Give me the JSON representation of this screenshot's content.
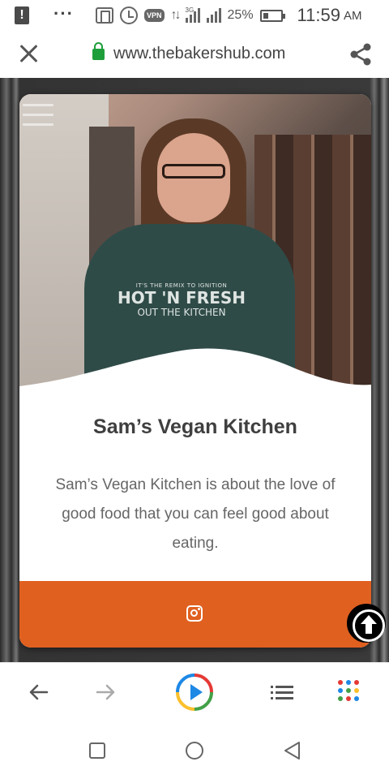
{
  "status_bar": {
    "alert_glyph": "!",
    "overflow_glyph": "···",
    "vpn_label": "VPN",
    "network_label": "3G",
    "battery": "25%",
    "time": "11:59",
    "ampm": "AM"
  },
  "browser": {
    "url": "www.thebakershub.com",
    "close_icon": "close-icon",
    "share_icon": "share-icon"
  },
  "hero": {
    "shirt_line1": "IT'S THE REMIX TO IGNITION",
    "shirt_line2": "HOT 'N FRESH",
    "shirt_line3": "OUT THE KITCHEN"
  },
  "card": {
    "title": "Sam’s Vegan Kitchen",
    "description": "Sam’s Vegan Kitchen is about the love of good food that you can feel good about eating.",
    "footer_icon": "instagram-icon"
  },
  "colors": {
    "accent": "#E06020",
    "lock_green": "#1E9E3A",
    "title_text": "#3F3F3F",
    "body_text": "#666666"
  },
  "bottom_toolbar": {
    "icons": [
      "back-arrow-icon",
      "forward-arrow-icon",
      "play-icon",
      "list-icon",
      "apps-grid-icon"
    ]
  }
}
